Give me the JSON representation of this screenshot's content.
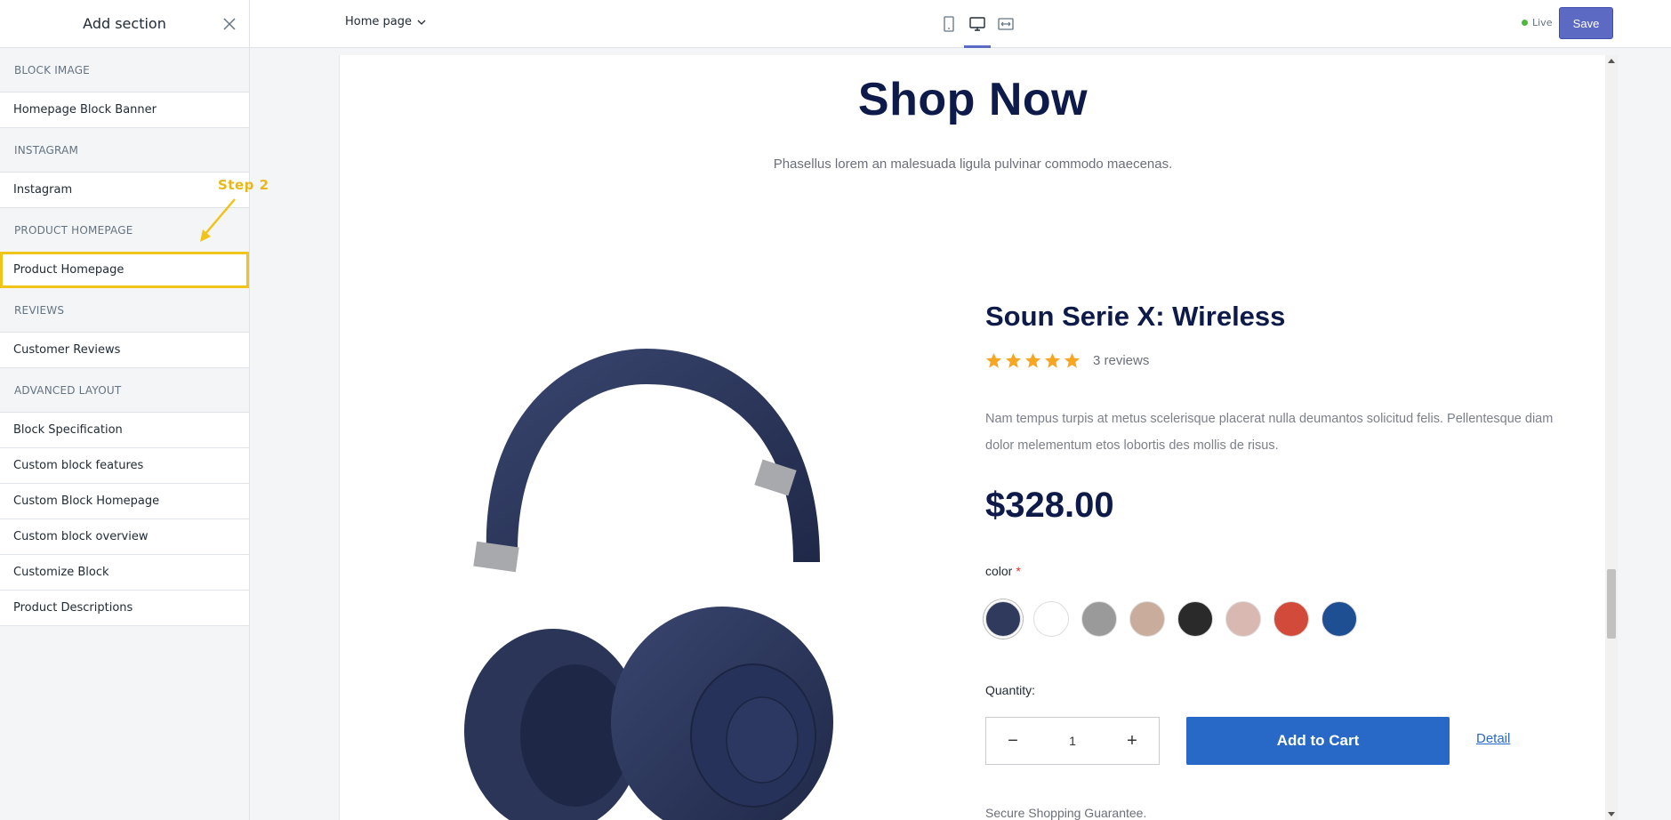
{
  "sidebar": {
    "title": "Add section",
    "groups": [
      {
        "title": "BLOCK IMAGE",
        "items": [
          "Homepage Block Banner"
        ]
      },
      {
        "title": "INSTAGRAM",
        "items": [
          "Instagram"
        ]
      },
      {
        "title": "PRODUCT HOMEPAGE",
        "items": [
          "Product Homepage"
        ]
      },
      {
        "title": "REVIEWS",
        "items": [
          "Customer Reviews"
        ]
      },
      {
        "title": "ADVANCED LAYOUT",
        "items": [
          "Block Specification",
          "Custom block features",
          "Custom Block Homepage",
          "Custom block overview",
          "Customize Block",
          "Product Descriptions"
        ]
      }
    ],
    "annotation": "Step 2"
  },
  "topbar": {
    "page_select": "Home page",
    "live_label": "Live",
    "save_label": "Save",
    "device_icons": [
      "mobile-icon",
      "desktop-icon",
      "fullwidth-icon"
    ],
    "active_device": "desktop-icon"
  },
  "preview": {
    "title": "Shop Now",
    "subtitle": "Phasellus lorem an malesuada ligula pulvinar commodo maecenas.",
    "product": {
      "name": "Soun Serie X: Wireless",
      "rating": 5,
      "reviews": "3 reviews",
      "description": "Nam tempus turpis at metus scelerisque placerat nulla deumantos solicitud felis. Pellentesque diam dolor melementum etos lobortis des mollis de risus.",
      "price": "$328.00",
      "color_label": "color",
      "required_mark": "*",
      "colors": [
        "#2f3a5c",
        "#ffffff",
        "#9a9a9a",
        "#c9ac9b",
        "#2a2a2a",
        "#d8b8b0",
        "#d24a3a",
        "#1f4f93"
      ],
      "quantity_label": "Quantity:",
      "quantity": "1",
      "minus": "−",
      "plus": "+",
      "add_to_cart": "Add to Cart",
      "detail": "Detail",
      "secure_text": "Secure Shopping Guarantee."
    }
  },
  "colors": {
    "accent": "#5c6ac4",
    "highlight": "#f0c419",
    "title": "#0d1a4a",
    "cart": "#2869c7",
    "star": "#f5a623"
  }
}
